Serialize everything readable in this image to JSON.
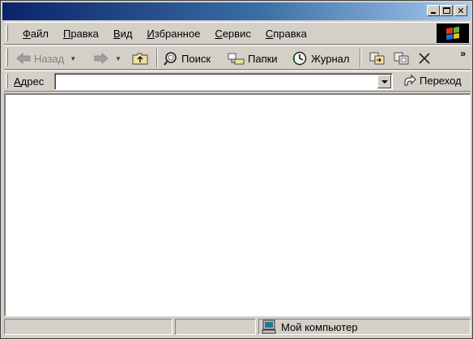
{
  "window": {
    "title": ""
  },
  "menu": {
    "items": [
      {
        "ul": "Ф",
        "rest": "айл"
      },
      {
        "ul": "П",
        "rest": "равка"
      },
      {
        "ul": "В",
        "rest": "ид"
      },
      {
        "ul": "И",
        "rest": "збранное"
      },
      {
        "ul": "С",
        "rest": "ервис"
      },
      {
        "ul": "С",
        "rest": "правка"
      }
    ]
  },
  "toolbar": {
    "back_label": "Назад",
    "search_label": "Поиск",
    "folders_label": "Папки",
    "history_label": "Журнал",
    "more_label": "»"
  },
  "address": {
    "label_ul": "А",
    "label_rest": "дрес",
    "value": "",
    "go_label": "Переход"
  },
  "status": {
    "pane1": "",
    "pane2": "",
    "zone_label": "Мой компьютер"
  },
  "colors": {
    "titlebar_start": "#0a246a",
    "titlebar_end": "#a6caf0",
    "chrome": "#d4d0c8"
  }
}
